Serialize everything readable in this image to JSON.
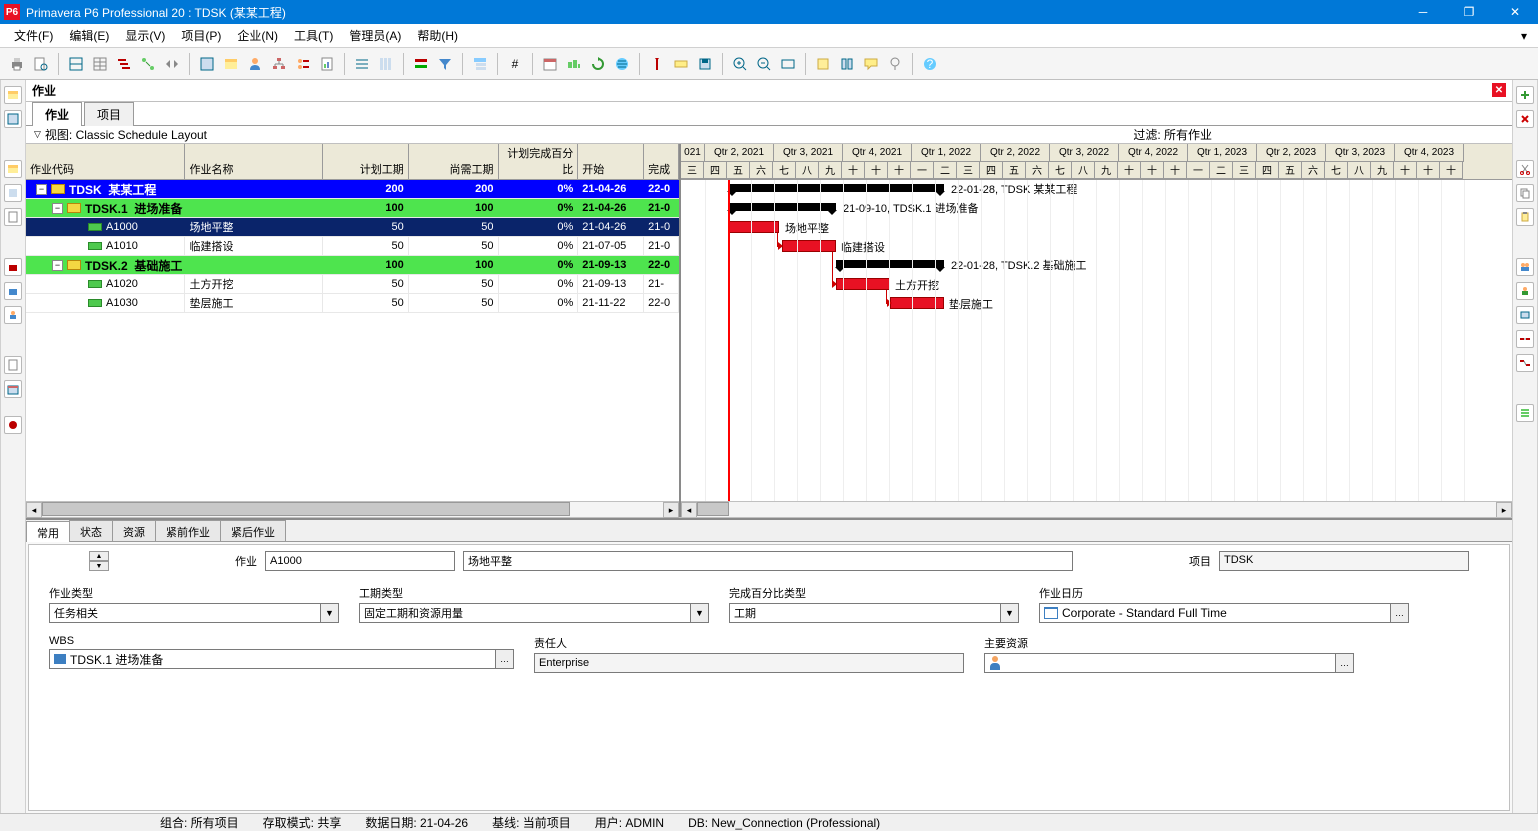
{
  "title": "Primavera P6 Professional 20 : TDSK (某某工程)",
  "appicon_text": "P6",
  "menu": [
    "文件(F)",
    "编辑(E)",
    "显示(V)",
    "项目(P)",
    "企业(N)",
    "工具(T)",
    "管理员(A)",
    "帮助(H)"
  ],
  "view_title": "作业",
  "view_tabs": [
    "作业",
    "项目"
  ],
  "layout_label": "视图: Classic Schedule Layout",
  "filter_label": "过滤: 所有作业",
  "table_headers": [
    "作业代码",
    "作业名称",
    "计划工期",
    "尚需工期",
    "计划完成百分比",
    "开始",
    "完成"
  ],
  "rows": [
    {
      "lvl": 0,
      "type": "wbs",
      "id": "TDSK",
      "name": "某某工程",
      "orig": 200,
      "rem": 200,
      "pct": "0%",
      "start": "21-04-26",
      "fin": "22-0"
    },
    {
      "lvl": 1,
      "type": "wbs",
      "id": "TDSK.1",
      "name": "进场准备",
      "orig": 100,
      "rem": 100,
      "pct": "0%",
      "start": "21-04-26",
      "fin": "21-0"
    },
    {
      "lvl": 2,
      "type": "act",
      "id": "A1000",
      "name": "场地平整",
      "orig": 50,
      "rem": 50,
      "pct": "0%",
      "start": "21-04-26",
      "fin": "21-0",
      "sel": true
    },
    {
      "lvl": 2,
      "type": "act",
      "id": "A1010",
      "name": "临建搭设",
      "orig": 50,
      "rem": 50,
      "pct": "0%",
      "start": "21-07-05",
      "fin": "21-0"
    },
    {
      "lvl": 1,
      "type": "wbs",
      "id": "TDSK.2",
      "name": "基础施工",
      "orig": 100,
      "rem": 100,
      "pct": "0%",
      "start": "21-09-13",
      "fin": "22-0"
    },
    {
      "lvl": 2,
      "type": "act",
      "id": "A1020",
      "name": "土方开挖",
      "orig": 50,
      "rem": 50,
      "pct": "0%",
      "start": "21-09-13",
      "fin": "21-"
    },
    {
      "lvl": 2,
      "type": "act",
      "id": "A1030",
      "name": "垫层施工",
      "orig": 50,
      "rem": 50,
      "pct": "0%",
      "start": "21-11-22",
      "fin": "22-0"
    }
  ],
  "quarters": [
    "021",
    "Qtr 2, 2021",
    "Qtr 3, 2021",
    "Qtr 4, 2021",
    "Qtr 1, 2022",
    "Qtr 2, 2022",
    "Qtr 3, 2022",
    "Qtr 4, 2022",
    "Qtr 1, 2023",
    "Qtr 2, 2023",
    "Qtr 3, 2023",
    "Qtr 4, 2023"
  ],
  "months": [
    "三",
    "四",
    "五",
    "六",
    "七",
    "八",
    "九",
    "十",
    "十",
    "十",
    "一",
    "二",
    "三",
    "四",
    "五",
    "六",
    "七",
    "八",
    "九",
    "十",
    "十",
    "十",
    "一",
    "二",
    "三",
    "四",
    "五",
    "六",
    "七",
    "八",
    "九",
    "十",
    "十",
    "十"
  ],
  "gantt_labels": {
    "proj": "22-01-28, TDSK 某某工程",
    "w1": "21-09-10, TDSK.1 进场准备",
    "a1": "场地平整",
    "a2": "临建搭设",
    "w2": "22-01-28, TDSK.2 基础施工",
    "a3": "土方开挖",
    "a4": "垫层施工"
  },
  "detail_tabs": [
    "常用",
    "状态",
    "资源",
    "紧前作业",
    "紧后作业"
  ],
  "detail": {
    "activity_label": "作业",
    "activity_id": "A1000",
    "activity_name": "场地平整",
    "project_label": "项目",
    "project_id": "TDSK",
    "fields": {
      "act_type_label": "作业类型",
      "act_type": "任务相关",
      "dur_type_label": "工期类型",
      "dur_type": "固定工期和资源用量",
      "pct_type_label": "完成百分比类型",
      "pct_type": "工期",
      "cal_label": "作业日历",
      "cal": "Corporate - Standard Full Time",
      "wbs_label": "WBS",
      "wbs": "TDSK.1 进场准备",
      "resp_label": "责任人",
      "resp": "Enterprise",
      "res_label": "主要资源",
      "res": ""
    }
  },
  "status": {
    "group": "组合: 所有项目",
    "access": "存取模式: 共享",
    "datadate": "数据日期: 21-04-26",
    "baseline": "基线: 当前项目",
    "user": "用户: ADMIN",
    "db": "DB: New_Connection (Professional)"
  }
}
